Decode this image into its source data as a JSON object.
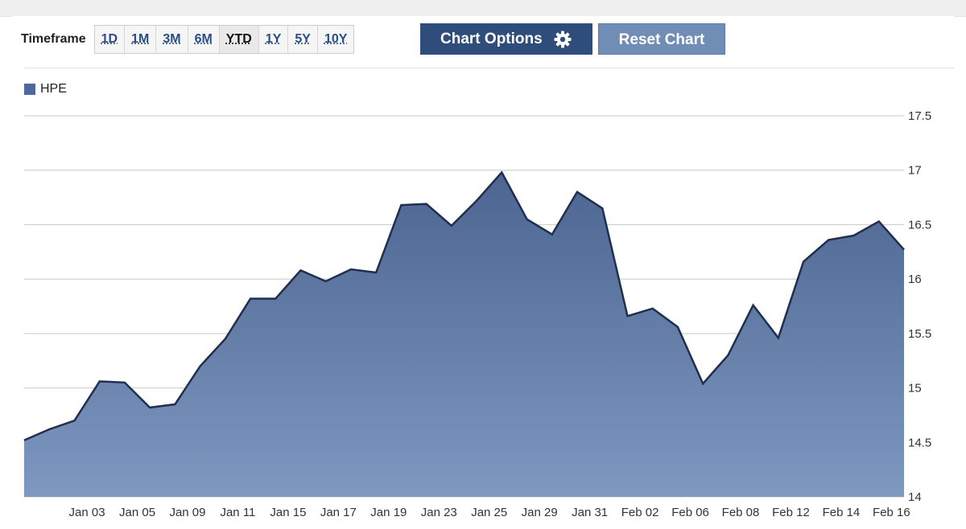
{
  "toolbar": {
    "timeframe_label": "Timeframe",
    "timeframes": [
      "1D",
      "1M",
      "3M",
      "6M",
      "YTD",
      "1Y",
      "5Y",
      "10Y"
    ],
    "active_timeframe": "YTD",
    "chart_options_label": "Chart Options",
    "reset_chart_label": "Reset Chart"
  },
  "colors": {
    "accent": "#2e4d7b",
    "secondary_button": "#6f8db5",
    "area_top": "#4c6591",
    "area_bottom": "#7f98c0",
    "line": "#1f2f4d"
  },
  "chart_data": {
    "type": "area",
    "title": "",
    "xlabel": "",
    "ylabel": "",
    "legend": {
      "placement": "top-left",
      "entries": [
        "HPE"
      ]
    },
    "grid": true,
    "ylim": [
      14,
      17.5
    ],
    "y_ticks": [
      "14",
      "14.5",
      "15",
      "15.5",
      "16",
      "16.5",
      "17",
      "17.5"
    ],
    "x_tick_labels": [
      "Jan 03",
      "Jan 05",
      "Jan 09",
      "Jan 11",
      "Jan 15",
      "Jan 17",
      "Jan 19",
      "Jan 23",
      "Jan 25",
      "Jan 29",
      "Jan 31",
      "Feb 02",
      "Feb 06",
      "Feb 08",
      "Feb 12",
      "Feb 14",
      "Feb 16"
    ],
    "series": [
      {
        "name": "HPE",
        "values": [
          14.52,
          14.62,
          14.7,
          15.06,
          15.05,
          14.82,
          14.85,
          15.2,
          15.45,
          15.82,
          15.82,
          16.08,
          15.98,
          16.09,
          16.06,
          16.68,
          16.69,
          16.49,
          16.72,
          16.98,
          16.55,
          16.41,
          16.8,
          16.65,
          15.66,
          15.73,
          15.56,
          15.04,
          15.3,
          15.76,
          15.46,
          16.16,
          16.36,
          16.4,
          16.53,
          16.27
        ]
      }
    ]
  }
}
